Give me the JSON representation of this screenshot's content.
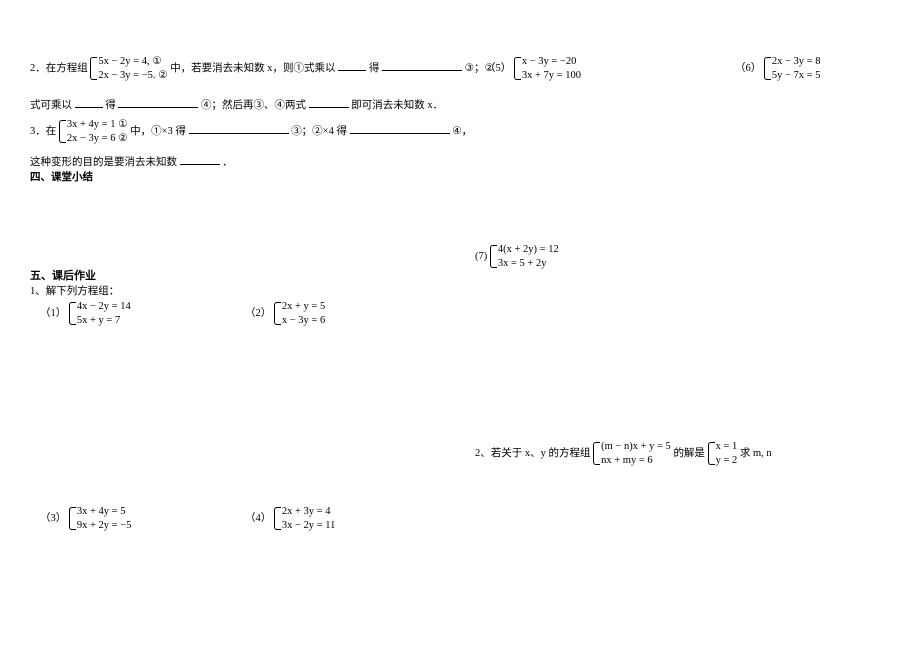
{
  "q2": {
    "lead": "2．在方程组",
    "sys1a": "5x − 2y = 4,   ①",
    "sys1b": "2x − 3y = −5.  ②",
    "mid": "中，若要消去未知数 x，则①式乘以",
    "after_blank1": "得",
    "label3": "③；②",
    "line2a": "式可乘以",
    "line2b": "得",
    "label4": "④；然后再③、④两式",
    "line2end": "即可消去未知数 x．"
  },
  "q2_r5": {
    "label": "（5）",
    "a": "x − 3y = −20",
    "b": "3x + 7y = 100"
  },
  "q2_r6": {
    "label": "（6）",
    "a": "2x − 3y = 8",
    "b": "5y − 7x = 5"
  },
  "q3": {
    "lead": "3．在",
    "a": "3x + 4y = 1   ①",
    "b": "2x − 3y = 6   ②",
    "mid": "中，①×3 得",
    "lbl3": "③；②×4 得",
    "lbl4": "④，",
    "line2": "这种变形的目的是要消去未知数",
    "dot": "．"
  },
  "h4": "四、课堂小结",
  "q7": {
    "label": "(7)",
    "a": "4(x + 2y) = 12",
    "b": "3x = 5 + 2y"
  },
  "h5": "五、课后作业",
  "h5sub": "1、解下列方程组：",
  "p1": {
    "label": "（1）",
    "a": "4x − 2y = 14",
    "b": "5x + y = 7"
  },
  "p2": {
    "label": "（2）",
    "a": "2x + y = 5",
    "b": "x − 3y = 6"
  },
  "p3": {
    "label": "（3）",
    "a": "3x + 4y = 5",
    "b": "9x + 2y = −5"
  },
  "p4": {
    "label": "（4）",
    "a": "2x + 3y = 4",
    "b": "3x − 2y = 11"
  },
  "q_extra": {
    "lead": "2、若关于 x、y 的方程组",
    "a": "(m − n)x + y = 5",
    "b": "nx + my = 6",
    "mid": "的解是",
    "sa": "x = 1",
    "sb": "y = 2",
    "tail": "求 m, n"
  }
}
